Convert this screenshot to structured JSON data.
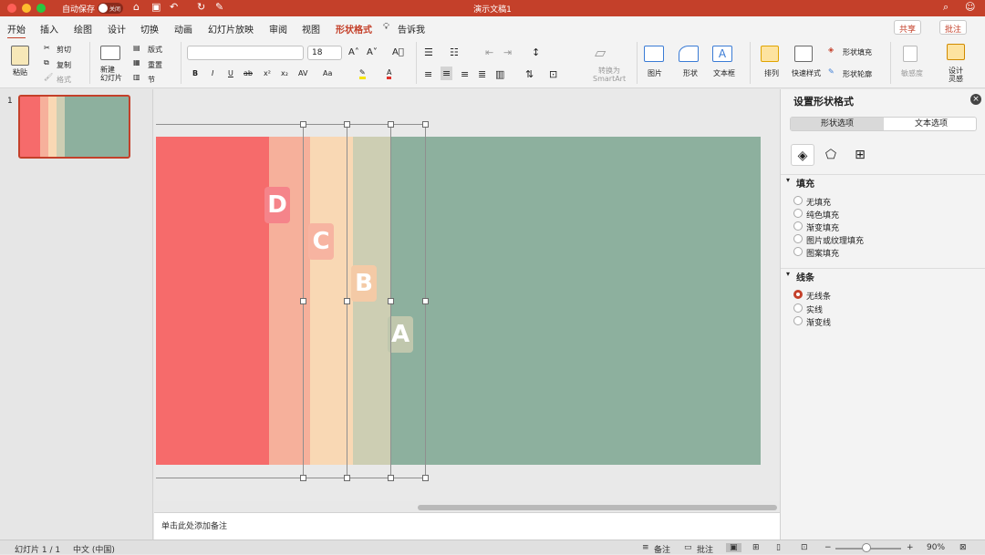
{
  "app": {
    "autosave_label": "自动保存",
    "autosave_state": "关闭",
    "doc_title": "演示文稿1"
  },
  "menu": {
    "tabs": [
      "开始",
      "插入",
      "绘图",
      "设计",
      "切换",
      "动画",
      "幻灯片放映",
      "审阅",
      "视图",
      "形状格式"
    ],
    "tell_me": "告诉我",
    "share": "共享",
    "comments": "批注"
  },
  "ribbon": {
    "paste": "粘贴",
    "cut": "剪切",
    "copy": "复制",
    "format_painter": "格式",
    "new_slide": "新建\n幻灯片",
    "layout": "版式",
    "reset": "重置",
    "section": "节",
    "font_name": "",
    "font_size": "18",
    "bold": "B",
    "italic": "I",
    "underline": "U",
    "strike": "ab",
    "superscript": "x²",
    "subscript": "x₂",
    "case": "Aa",
    "spacing": "AV",
    "smartart": "转换为\nSmartArt",
    "picture": "图片",
    "shape": "形状",
    "textbox": "文本框",
    "arrange": "排列",
    "quick_styles": "快速样式",
    "shape_fill": "形状填充",
    "shape_outline": "形状轮廓",
    "sensitivity": "敏感度",
    "designer": "设计\n灵感"
  },
  "thumbs": {
    "number": "1"
  },
  "slide": {
    "stripes": [
      {
        "label": "D",
        "color": "#f66b6b"
      },
      {
        "label": "C",
        "color": "#f6b09b"
      },
      {
        "label": "B",
        "color": "#f9d8b4"
      },
      {
        "label": "A",
        "color": "#cdceb3"
      }
    ],
    "background": "#8db09e"
  },
  "notes": {
    "placeholder": "单击此处添加备注"
  },
  "format_panel": {
    "title": "设置形状格式",
    "tabs": [
      "形状选项",
      "文本选项"
    ],
    "fill_section": "填充",
    "fill_options": [
      "无填充",
      "纯色填充",
      "渐变填充",
      "图片或纹理填充",
      "图案填充"
    ],
    "line_section": "线条",
    "line_options": [
      "无线条",
      "实线",
      "渐变线"
    ],
    "line_selected": 0
  },
  "status": {
    "slide": "幻灯片 1 / 1",
    "language": "中文 (中国)",
    "notes": "备注",
    "comments": "批注",
    "zoom": "90%"
  },
  "colors": {
    "accent": "#c4402a"
  }
}
